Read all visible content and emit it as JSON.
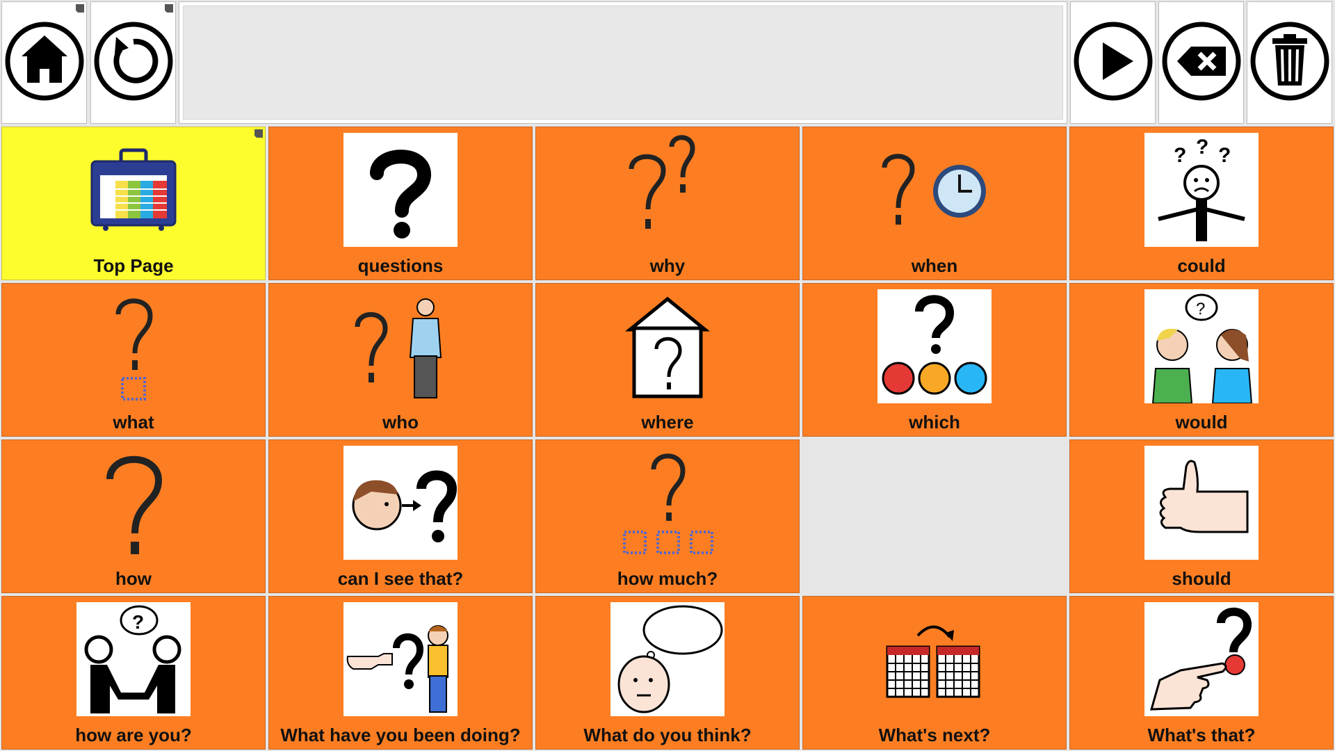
{
  "toolbar": {
    "home_icon": "home-icon",
    "undo_icon": "undo-icon",
    "speak_icon": "play-icon",
    "backspace_icon": "backspace-icon",
    "clear_icon": "trash-icon"
  },
  "message_bar": {
    "text": ""
  },
  "grid": {
    "cells": [
      {
        "label": "Top Page",
        "icon": "folder-board-icon",
        "color": "#fdfc2d"
      },
      {
        "label": "questions",
        "icon": "question-mark-icon",
        "color": "#fd7e22"
      },
      {
        "label": "why",
        "icon": "two-question-marks-icon",
        "color": "#fd7e22"
      },
      {
        "label": "when",
        "icon": "question-clock-icon",
        "color": "#fd7e22"
      },
      {
        "label": "could",
        "icon": "confused-person-icon",
        "color": "#fd7e22"
      },
      {
        "label": "what",
        "icon": "question-square-icon",
        "color": "#fd7e22"
      },
      {
        "label": "who",
        "icon": "question-person-icon",
        "color": "#fd7e22"
      },
      {
        "label": "where",
        "icon": "question-house-icon",
        "color": "#fd7e22"
      },
      {
        "label": "which",
        "icon": "question-colored-dots-icon",
        "color": "#fd7e22"
      },
      {
        "label": "would",
        "icon": "two-people-talking-icon",
        "color": "#fd7e22"
      },
      {
        "label": "how",
        "icon": "big-question-mark-icon",
        "color": "#fd7e22"
      },
      {
        "label": "can I see that?",
        "icon": "face-looking-question-icon",
        "color": "#fd7e22"
      },
      {
        "label": "how much?",
        "icon": "question-three-squares-icon",
        "color": "#fd7e22"
      },
      {
        "label": "should",
        "icon": "thumbs-up-icon",
        "color": "#fd7e22"
      },
      {
        "label": "how are you?",
        "icon": "handshake-question-icon",
        "color": "#fd7e22"
      },
      {
        "label": "What have you been doing?",
        "icon": "point-question-boy-icon",
        "color": "#fd7e22"
      },
      {
        "label": "What do you think?",
        "icon": "thinking-head-icon",
        "color": "#fd7e22"
      },
      {
        "label": "What's next?",
        "icon": "calendar-next-icon",
        "color": "#fd7e22"
      },
      {
        "label": "What's that?",
        "icon": "pointing-question-icon",
        "color": "#fd7e22"
      }
    ]
  }
}
